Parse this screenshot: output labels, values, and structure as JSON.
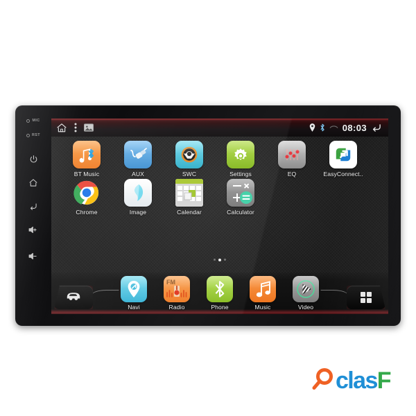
{
  "device": {
    "name": "Android Car Head Unit",
    "side_keys": [
      {
        "label": "MIC",
        "icon": "mic-indicator",
        "type": "label"
      },
      {
        "label": "RST",
        "icon": "reset-pinhole",
        "type": "label"
      },
      {
        "label": "",
        "icon": "power-icon",
        "type": "button"
      },
      {
        "label": "",
        "icon": "home-icon",
        "type": "button"
      },
      {
        "label": "",
        "icon": "back-icon",
        "type": "button"
      },
      {
        "label": "",
        "icon": "volume-up-icon",
        "type": "button"
      },
      {
        "label": "",
        "icon": "volume-down-icon",
        "type": "button"
      }
    ]
  },
  "statusbar": {
    "home_icon": "home-icon",
    "menu_icon": "overflow-menu-icon",
    "screenshot_icon": "screenshot-icon",
    "location_icon": "location-pin-icon",
    "bluetooth_icon": "bluetooth-icon",
    "signal_icon": "signal-icon",
    "clock": "08:03",
    "back_icon": "back-arrow-icon"
  },
  "home": {
    "apps_row1": [
      {
        "label": "BT Music",
        "icon": "bt-music-icon",
        "color": "#f58a2e"
      },
      {
        "label": "AUX",
        "icon": "aux-plug-icon",
        "color": "#4ea3e0"
      },
      {
        "label": "SWC",
        "icon": "steering-wheel-icon",
        "color": "#4cc4d8"
      },
      {
        "label": "Settings",
        "icon": "gear-icon",
        "color": "#9ccc36"
      },
      {
        "label": "EQ",
        "icon": "equalizer-icon",
        "color": "#a8a8a8"
      },
      {
        "label": "EasyConnect..",
        "icon": "easyconnect-icon",
        "color": "#ffffff"
      }
    ],
    "apps_row2": [
      {
        "label": "Chrome",
        "icon": "chrome-icon",
        "color": "#ffffff"
      },
      {
        "label": "Image",
        "icon": "gallery-icon",
        "color": "#f2f2f2"
      },
      {
        "label": "Calendar",
        "icon": "calendar-icon",
        "color": "#d8d8d8"
      },
      {
        "label": "Calculator",
        "icon": "calculator-icon",
        "color": "#8d8d8d"
      }
    ],
    "page_indicator": {
      "pages": 3,
      "current": 2
    }
  },
  "dock": {
    "left_key_icon": "car-icon",
    "right_key_icon": "apps-grid-icon",
    "items": [
      {
        "label": "Navi",
        "icon": "navigation-pin-icon",
        "color": "#4ec3e0"
      },
      {
        "label": "Radio",
        "icon": "fm-radio-icon",
        "color": "#f5883a",
        "badge": "FM"
      },
      {
        "label": "Phone",
        "icon": "bt-phone-icon",
        "color": "#9ccc36"
      },
      {
        "label": "Music",
        "icon": "music-note-icon",
        "color": "#f58330"
      },
      {
        "label": "Video",
        "icon": "video-play-icon",
        "color": "#8d8d8d"
      }
    ]
  },
  "watermark": {
    "text_c": "clas",
    "text_f": "F",
    "magnifier_icon": "magnifier-icon",
    "color_accent": "#ef6124"
  }
}
